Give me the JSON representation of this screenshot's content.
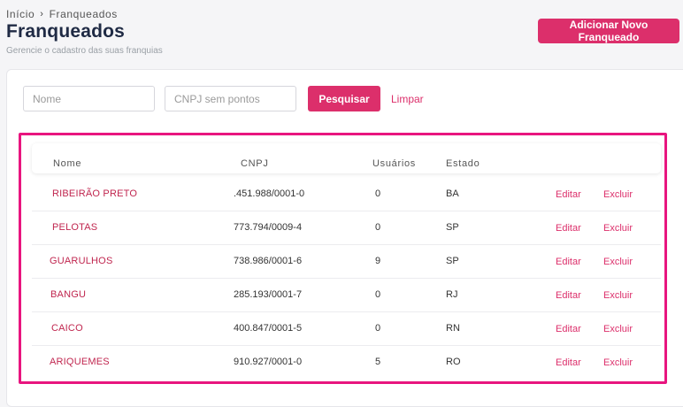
{
  "breadcrumb": {
    "home": "Início",
    "separator": "›",
    "current": "Franqueados"
  },
  "page": {
    "title": "Franqueados",
    "subtitle": "Gerencie o cadastro das suas franquias"
  },
  "actions": {
    "add_label": "Adicionar Novo Franqueado"
  },
  "filters": {
    "name_placeholder": "Nome",
    "cnpj_placeholder": "CNPJ sem pontos",
    "search_label": "Pesquisar",
    "clear_label": "Limpar"
  },
  "table": {
    "headers": {
      "name": "Nome",
      "cnpj": "CNPJ",
      "users": "Usuários",
      "state": "Estado"
    },
    "edit_label": "Editar",
    "delete_label": "Excluir",
    "rows": [
      {
        "name": "RIBEIRÃO PRETO",
        "cnpj": ".451.988/0001-0",
        "users": "0",
        "state": "BA"
      },
      {
        "name": "PELOTAS",
        "cnpj": "773.794/0009-4",
        "users": "0",
        "state": "SP"
      },
      {
        "name": "GUARULHOS",
        "cnpj": "738.986/0001-6",
        "users": "9",
        "state": "SP"
      },
      {
        "name": "BANGU",
        "cnpj": "285.193/0001-7",
        "users": "0",
        "state": "RJ"
      },
      {
        "name": "CAICO",
        "cnpj": "400.847/0001-5",
        "users": "0",
        "state": "RN"
      },
      {
        "name": "ARIQUEMES",
        "cnpj": "910.927/0001-0",
        "users": "5",
        "state": "RO"
      }
    ]
  },
  "colors": {
    "accent": "#dc2f6b",
    "highlight_border": "#e8157f",
    "title": "#1f2a44"
  }
}
